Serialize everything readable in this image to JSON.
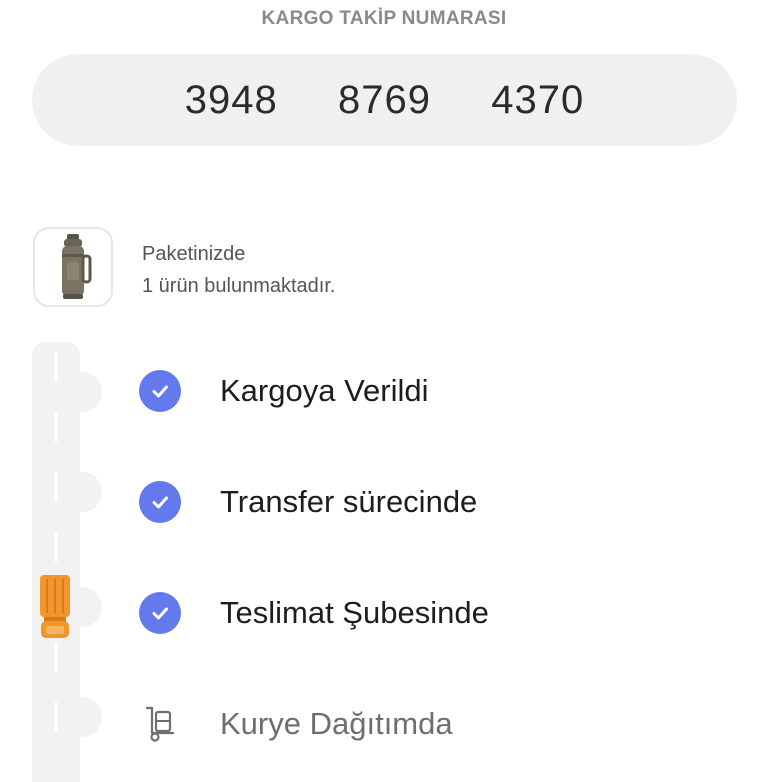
{
  "header": {
    "title": "KARGO TAKİP NUMARASI"
  },
  "tracking": {
    "number": "3948  8769  4370"
  },
  "package": {
    "line1": "Paketinizde",
    "line2": "1 ürün bulunmaktadır.",
    "product_icon": "thermos-bottle-image"
  },
  "steps": [
    {
      "label": "Kargoya Verildi",
      "status": "done",
      "icon": "check-circle-icon"
    },
    {
      "label": "Transfer sürecinde",
      "status": "done",
      "icon": "check-circle-icon"
    },
    {
      "label": "Teslimat Şubesinde",
      "status": "done",
      "icon": "check-circle-icon"
    },
    {
      "label": "Kurye Dağıtımda",
      "status": "pending",
      "icon": "courier-dolly-icon"
    }
  ],
  "colors": {
    "accent": "#6479ec",
    "truck": "#f0962a",
    "pill_background": "#f0f0f0",
    "road": "#f2f2f2"
  }
}
